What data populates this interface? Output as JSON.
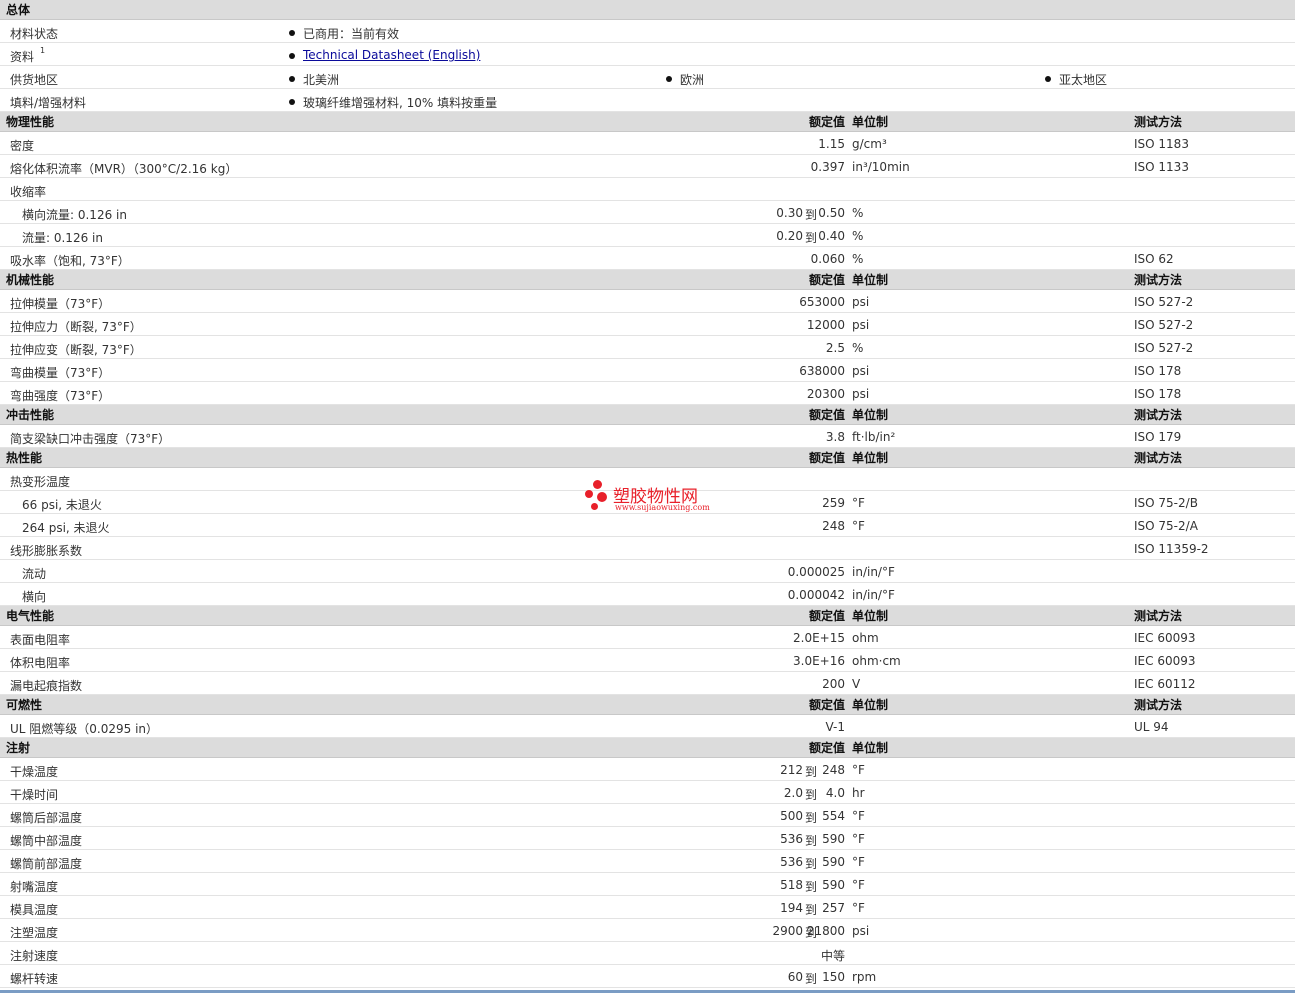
{
  "headers": {
    "value": "额定值",
    "unit": "单位制",
    "method": "测试方法"
  },
  "watermark": {
    "title": "塑胶物性网",
    "url": "www.sujiaowuxing.com"
  },
  "rows": [
    {
      "type": "section",
      "label": "总体",
      "headers": false
    },
    {
      "type": "bullets",
      "label": "材料状态",
      "items": [
        "已商用：当前有效"
      ]
    },
    {
      "type": "bullets",
      "label": "资料",
      "sup": "1",
      "items": [
        "Technical Datasheet (English)"
      ],
      "link": true
    },
    {
      "type": "bullets",
      "label": "供货地区",
      "items": [
        "北美洲",
        "欧洲",
        "亚太地区"
      ]
    },
    {
      "type": "bullets",
      "label": "填料/增强材料",
      "items": [
        "玻璃纤维增强材料, 10% 填料按重量"
      ]
    },
    {
      "type": "section",
      "label": "物理性能",
      "headers": true,
      "method": true
    },
    {
      "type": "data",
      "label": "密度",
      "value": "1.15",
      "unit": "g/cm³",
      "method": "ISO 1183"
    },
    {
      "type": "data",
      "label": "熔化体积流率（MVR）（300°C/2.16 kg）",
      "value": "0.397",
      "unit": "in³/10min",
      "method": "ISO 1133"
    },
    {
      "type": "data",
      "label": "收缩率"
    },
    {
      "type": "data",
      "label": "横向流量: 0.126 in",
      "indent": true,
      "range": [
        "0.30",
        "0.50"
      ],
      "unit": "%"
    },
    {
      "type": "data",
      "label": "流量: 0.126 in",
      "indent": true,
      "range": [
        "0.20",
        "0.40"
      ],
      "unit": "%"
    },
    {
      "type": "data",
      "label": "吸水率（饱和, 73°F）",
      "value": "0.060",
      "unit": "%",
      "method": "ISO 62"
    },
    {
      "type": "section",
      "label": "机械性能",
      "headers": true,
      "method": true
    },
    {
      "type": "data",
      "label": "拉伸模量（73°F）",
      "value": "653000",
      "unit": "psi",
      "method": "ISO 527-2"
    },
    {
      "type": "data",
      "label": "拉伸应力（断裂, 73°F）",
      "value": "12000",
      "unit": "psi",
      "method": "ISO 527-2"
    },
    {
      "type": "data",
      "label": "拉伸应变（断裂, 73°F）",
      "value": "2.5",
      "unit": "%",
      "method": "ISO 527-2"
    },
    {
      "type": "data",
      "label": "弯曲模量（73°F）",
      "value": "638000",
      "unit": "psi",
      "method": "ISO 178"
    },
    {
      "type": "data",
      "label": "弯曲强度（73°F）",
      "value": "20300",
      "unit": "psi",
      "method": "ISO 178"
    },
    {
      "type": "section",
      "label": "冲击性能",
      "headers": true,
      "method": true
    },
    {
      "type": "data",
      "label": "简支梁缺口冲击强度（73°F）",
      "value": "3.8",
      "unit": "ft·lb/in²",
      "method": "ISO 179"
    },
    {
      "type": "section",
      "label": "热性能",
      "headers": true,
      "method": true
    },
    {
      "type": "data",
      "label": "热变形温度"
    },
    {
      "type": "data",
      "label": "66 psi, 未退火",
      "indent": true,
      "value": "259",
      "unit": "°F",
      "method": "ISO 75-2/B"
    },
    {
      "type": "data",
      "label": "264 psi, 未退火",
      "indent": true,
      "value": "248",
      "unit": "°F",
      "method": "ISO 75-2/A"
    },
    {
      "type": "data",
      "label": "线形膨胀系数",
      "method": "ISO 11359-2"
    },
    {
      "type": "data",
      "label": "流动",
      "indent": true,
      "value": "0.000025",
      "unit": "in/in/°F"
    },
    {
      "type": "data",
      "label": "横向",
      "indent": true,
      "value": "0.000042",
      "unit": "in/in/°F"
    },
    {
      "type": "section",
      "label": "电气性能",
      "headers": true,
      "method": true
    },
    {
      "type": "data",
      "label": "表面电阻率",
      "value": "2.0E+15",
      "unit": "ohm",
      "method": "IEC 60093"
    },
    {
      "type": "data",
      "label": "体积电阻率",
      "value": "3.0E+16",
      "unit": "ohm·cm",
      "method": "IEC 60093"
    },
    {
      "type": "data",
      "label": "漏电起痕指数",
      "value": "200",
      "unit": "V",
      "method": "IEC 60112"
    },
    {
      "type": "section",
      "label": "可燃性",
      "headers": true,
      "method": true
    },
    {
      "type": "data",
      "label": "UL 阻燃等级（0.0295 in）",
      "value": "V-1",
      "method": "UL 94"
    },
    {
      "type": "section",
      "label": "注射",
      "headers": true,
      "method": false
    },
    {
      "type": "data",
      "label": "干燥温度",
      "range": [
        "212",
        "248"
      ],
      "unit": "°F"
    },
    {
      "type": "data",
      "label": "干燥时间",
      "range": [
        "2.0",
        "4.0"
      ],
      "unit": "hr"
    },
    {
      "type": "data",
      "label": "螺筒后部温度",
      "range": [
        "500",
        "554"
      ],
      "unit": "°F"
    },
    {
      "type": "data",
      "label": "螺筒中部温度",
      "range": [
        "536",
        "590"
      ],
      "unit": "°F"
    },
    {
      "type": "data",
      "label": "螺筒前部温度",
      "range": [
        "536",
        "590"
      ],
      "unit": "°F"
    },
    {
      "type": "data",
      "label": "射嘴温度",
      "range": [
        "518",
        "590"
      ],
      "unit": "°F"
    },
    {
      "type": "data",
      "label": "模具温度",
      "range": [
        "194",
        "257"
      ],
      "unit": "°F"
    },
    {
      "type": "data",
      "label": "注塑温度",
      "range": [
        "2900",
        "21800"
      ],
      "unit": "psi"
    },
    {
      "type": "data",
      "label": "注射速度",
      "value": "中等"
    },
    {
      "type": "data",
      "label": "螺杆转速",
      "range": [
        "60",
        "150"
      ],
      "unit": "rpm"
    }
  ]
}
